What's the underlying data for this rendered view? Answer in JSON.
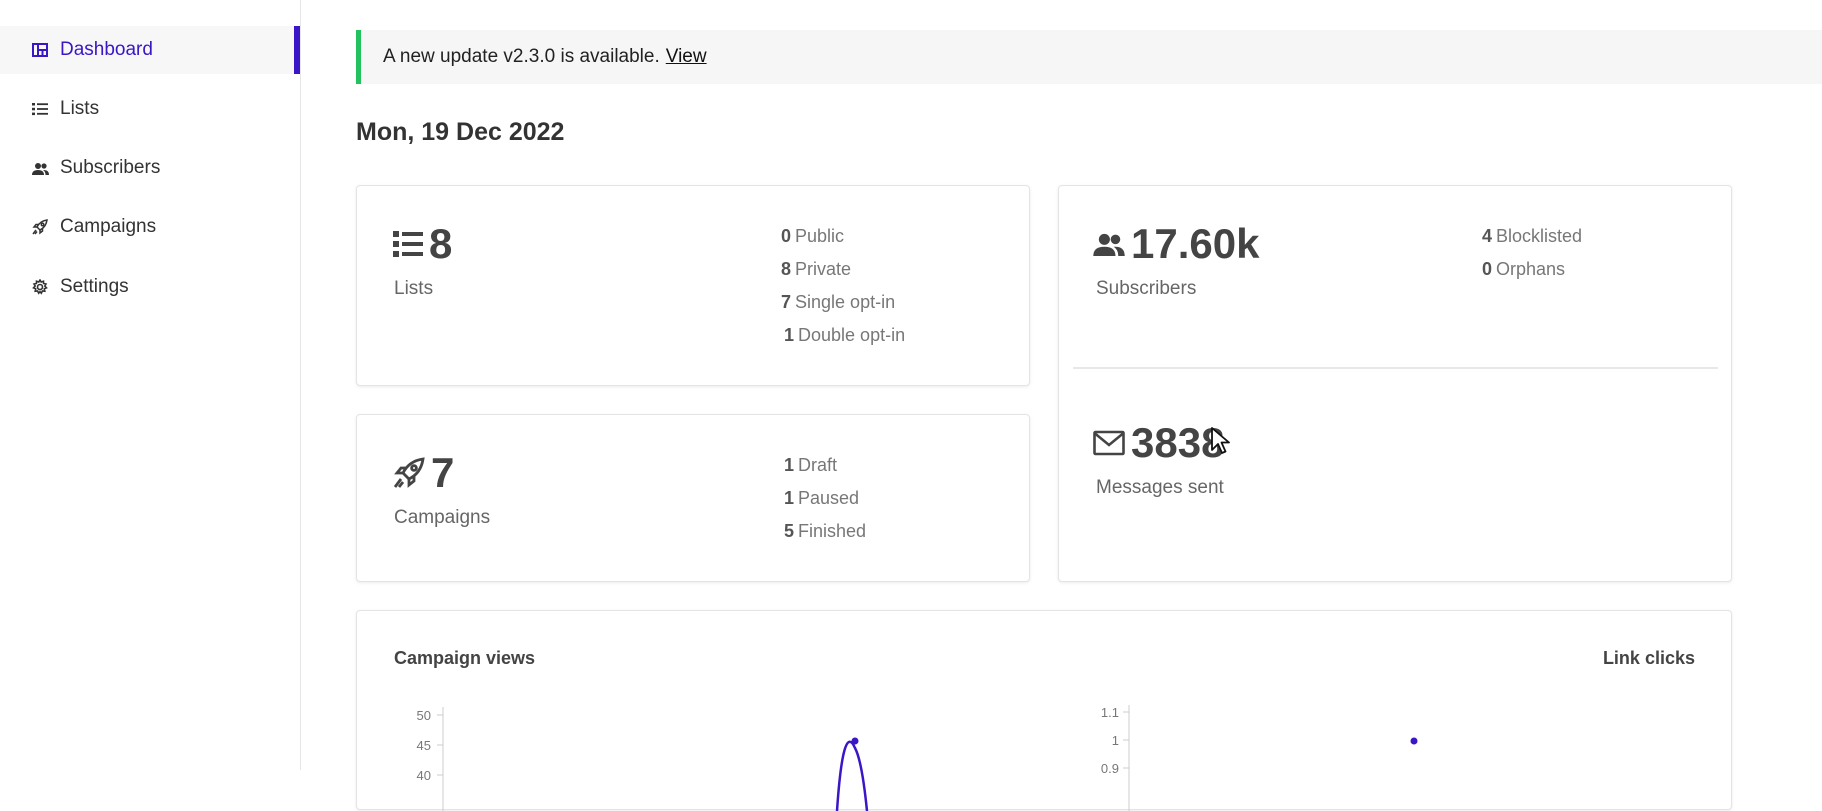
{
  "sidebar": {
    "items": [
      {
        "label": "Dashboard",
        "icon": "dashboard-icon",
        "active": true
      },
      {
        "label": "Lists",
        "icon": "list-icon"
      },
      {
        "label": "Subscribers",
        "icon": "users-icon"
      },
      {
        "label": "Campaigns",
        "icon": "rocket-icon"
      },
      {
        "label": "Settings",
        "icon": "gear-icon"
      }
    ]
  },
  "banner": {
    "text": "A new update v2.3.0 is available.",
    "link": "View",
    "accent": "#22c35e"
  },
  "date": "Mon, 19 Dec 2022",
  "lists_card": {
    "count": "8",
    "label": "Lists",
    "stats": [
      {
        "value": "0",
        "label": "Public"
      },
      {
        "value": "8",
        "label": "Private"
      },
      {
        "value": "7",
        "label": "Single opt-in"
      },
      {
        "value": "1",
        "label": "Double opt-in"
      }
    ]
  },
  "campaigns_card": {
    "count": "7",
    "label": "Campaigns",
    "stats": [
      {
        "value": "1",
        "label": "Draft"
      },
      {
        "value": "1",
        "label": "Paused"
      },
      {
        "value": "5",
        "label": "Finished"
      }
    ]
  },
  "subscribers_card": {
    "count": "17.60k",
    "label": "Subscribers",
    "stats": [
      {
        "value": "4",
        "label": "Blocklisted"
      },
      {
        "value": "0",
        "label": "Orphans"
      }
    ],
    "messages_count": "3838",
    "messages_label": "Messages sent"
  },
  "charts": {
    "views_title": "Campaign views",
    "clicks_title": "Link clicks",
    "views_ticks": [
      "50",
      "45",
      "40"
    ],
    "clicks_ticks": [
      "1.1",
      "1",
      "0.9"
    ],
    "accent": "#3a16c7"
  }
}
